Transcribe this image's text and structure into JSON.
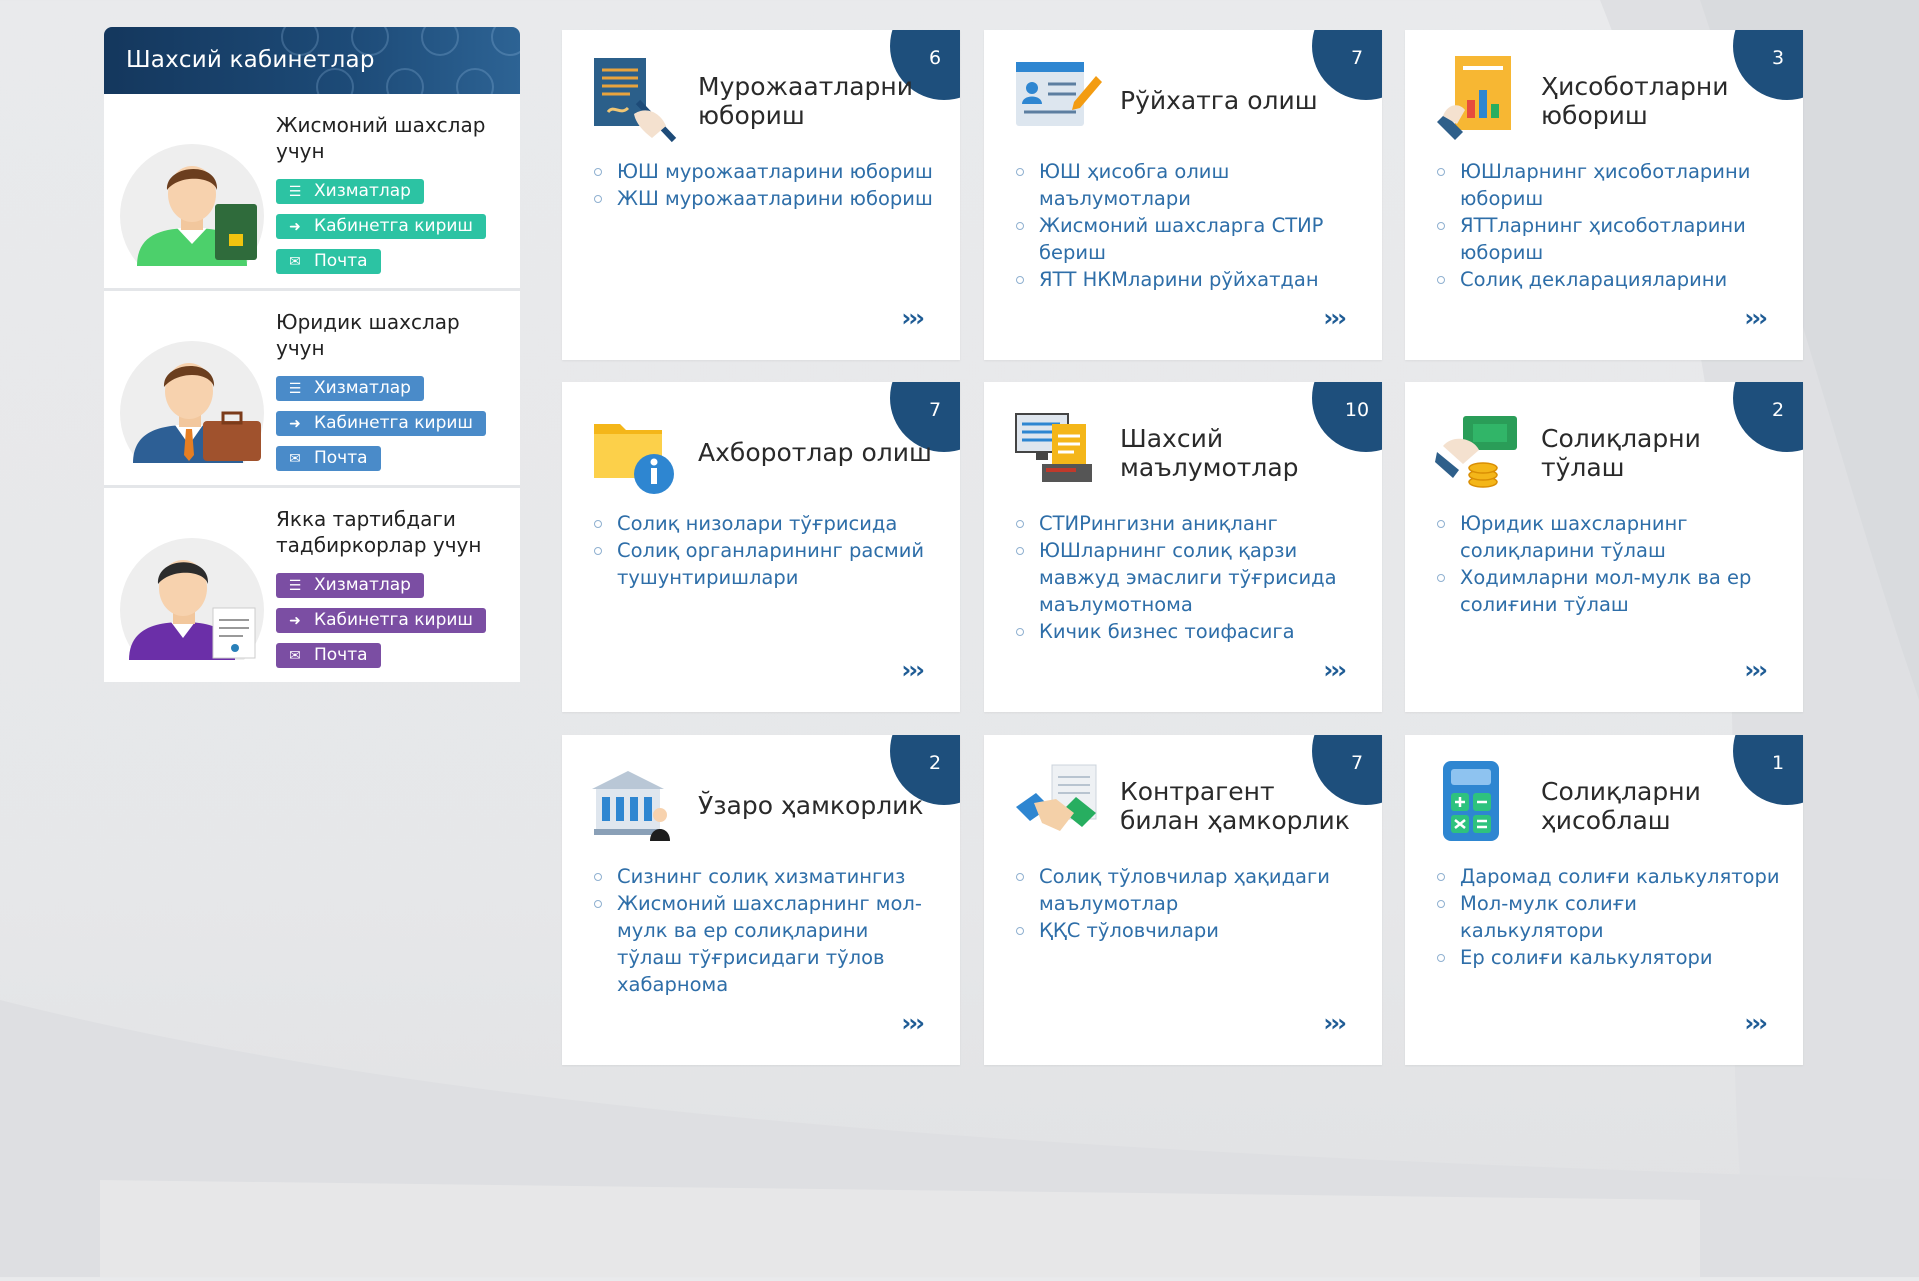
{
  "cabinets": {
    "title": "Шахсий кабинетлар",
    "persons": [
      {
        "title": "Жисмоний шахслар учун",
        "services": "Хизматлар",
        "login": "Кабинетга кириш",
        "mail": "Почта",
        "color": "teal"
      },
      {
        "title": "Юридик шахслар учун",
        "services": "Хизматлар",
        "login": "Кабинетга кириш",
        "mail": "Почта",
        "color": "blue"
      },
      {
        "title": "Якка тартибдаги тадбиркорлар учун",
        "services": "Хизматлар",
        "login": "Кабинетга кириш",
        "mail": "Почта",
        "color": "purple"
      }
    ]
  },
  "cards": [
    {
      "title": "Мурожаатларни юбориш",
      "count": "6",
      "icon": "document-signing-icon",
      "links": [
        "ЮШ мурожаатларини юбориш",
        "ЖШ мурожаатларини юбориш"
      ],
      "more": "›››"
    },
    {
      "title": "Рўйхатга олиш",
      "count": "7",
      "icon": "registration-form-icon",
      "links": [
        "ЮШ ҳисобга олиш маълумотлари",
        "Жисмоний шахсларга СТИР бериш",
        "ЯТТ НКМларини рўйхатдан"
      ],
      "more": "›››"
    },
    {
      "title": "Ҳисоботларни юбориш",
      "count": "3",
      "icon": "report-chart-icon",
      "links": [
        "ЮШларнинг ҳисоботларини юбориш",
        "ЯТТларнинг ҳисоботларини юбориш",
        "Солиқ декларацияларини"
      ],
      "more": "›››"
    },
    {
      "title": "Ахборотлар олиш",
      "count": "7",
      "icon": "info-folder-icon",
      "links": [
        "Солиқ низолари тўғрисида",
        "Солиқ органларининг расмий тушунтиришлари"
      ],
      "more": "›››"
    },
    {
      "title": "Шахсий маълумотлар",
      "count": "10",
      "icon": "computer-documents-icon",
      "links": [
        "СТИРингизни аниқланг",
        "ЮШларнинг солиқ қарзи мавжуд эмаслиги тўғрисида маълумотнома",
        "Кичик бизнес тоифасига"
      ],
      "more": "›››"
    },
    {
      "title": "Солиқларни тўлаш",
      "count": "2",
      "icon": "payment-coins-icon",
      "links": [
        "Юридик шахсларнинг солиқларини тўлаш",
        "Ходимларни мол-мулк ва ер солиғини тўлаш"
      ],
      "more": "›››"
    },
    {
      "title": "Ўзаро ҳамкорлик",
      "count": "2",
      "icon": "government-building-icon",
      "links": [
        "Сизнинг солиқ хизматингиз",
        "Жисмоний шахсларнинг мол-мулк ва ер солиқларини тўлаш тўғрисидаги тўлов хабарнома"
      ],
      "more": "›››"
    },
    {
      "title": "Контрагент билан ҳамкорлик",
      "count": "7",
      "icon": "handshake-icon",
      "links": [
        "Солиқ тўловчилар ҳақидаги маълумотлар",
        "ҚҚС тўловчилари"
      ],
      "more": "›››"
    },
    {
      "title": "Солиқларни ҳисоблаш",
      "count": "1",
      "icon": "calculator-icon",
      "links": [
        "Даромад солиғи калькулятори",
        "Мол-мулк солиғи калькулятори",
        "Ер солиғи калькулятори"
      ],
      "more": "›››"
    }
  ],
  "colors": {
    "header": "#1d4b78",
    "badge": "#1e4f7c",
    "link": "#2e6ea8",
    "teal": "#2cc3a3",
    "blue": "#4a8bc9",
    "purple": "#7b4ea3"
  }
}
